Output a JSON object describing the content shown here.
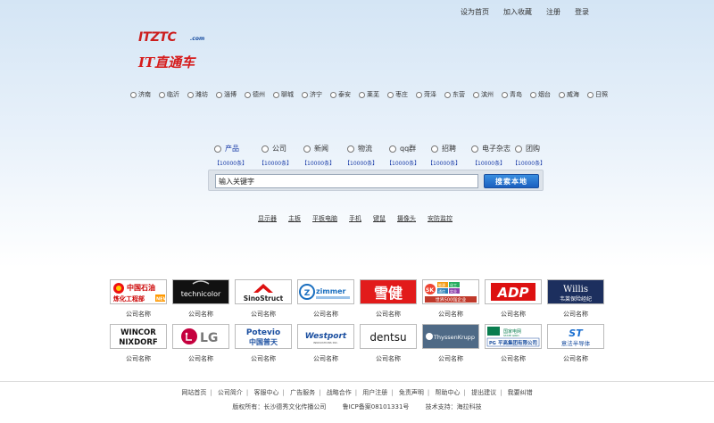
{
  "top_links": [
    "设为首页",
    "加入收藏",
    "注册",
    "登录"
  ],
  "logo": {
    "brand_en": "ITZTC",
    "brand_dotcom": ".com",
    "brand_cn": "IT直通车"
  },
  "cities": [
    "济南",
    "临沂",
    "潍坊",
    "淄博",
    "德州",
    "聊城",
    "济宁",
    "泰安",
    "莱芜",
    "枣庄",
    "菏泽",
    "东营",
    "滨州",
    "青岛",
    "烟台",
    "威海",
    "日照"
  ],
  "categories": [
    {
      "label": "产品",
      "count": "【10000条】",
      "selected": true
    },
    {
      "label": "公司",
      "count": "【10000条】"
    },
    {
      "label": "新闻",
      "count": "【10000条】"
    },
    {
      "label": "物流",
      "count": "【10000条】"
    },
    {
      "label": "qq群",
      "count": "【10000条】"
    },
    {
      "label": "招聘",
      "count": "【10000条】"
    },
    {
      "label": "电子杂志",
      "count": "【10000条】"
    },
    {
      "label": "团购",
      "count": "【10000条】"
    }
  ],
  "search": {
    "value": "输入关键字",
    "button": "搜索本地"
  },
  "hot_words": [
    "显示器",
    "主板",
    "平板电脑",
    "手机",
    "键鼠",
    "摄像头",
    "安防监控"
  ],
  "companies": [
    {
      "logo": "中国石油 炼化工程部 NEW",
      "caption": "公司名称"
    },
    {
      "logo": "technicolor",
      "caption": "公司名称"
    },
    {
      "logo": "SinoStruct",
      "caption": "公司名称"
    },
    {
      "logo": "zimmer",
      "caption": "公司名称"
    },
    {
      "logo": "雪健",
      "caption": "公司名称"
    },
    {
      "logo": "SK 能源 化工 通信 实业 世界500强企业",
      "caption": "公司名称"
    },
    {
      "logo": "ADP",
      "caption": "公司名称"
    },
    {
      "logo": "Willis 韦莱保险经纪",
      "caption": "公司名称"
    },
    {
      "logo": "WINCOR NIXDORF",
      "caption": "公司名称"
    },
    {
      "logo": "LG",
      "caption": "公司名称"
    },
    {
      "logo": "Potevio 中国普天",
      "caption": "公司名称"
    },
    {
      "logo": "Westport",
      "caption": "公司名称"
    },
    {
      "logo": "dentsu",
      "caption": "公司名称"
    },
    {
      "logo": "ThyssenKrupp",
      "caption": "公司名称"
    },
    {
      "logo": "国家电网 平高集团有限公司",
      "caption": "公司名称"
    },
    {
      "logo": "ST 意法半导体",
      "caption": "公司名称"
    }
  ],
  "footer": {
    "nav": [
      "网站首页",
      "公司简介",
      "客服中心",
      "广告服务",
      "战略合作",
      "用户注册",
      "免责声明",
      "帮助中心",
      "提出建议",
      "我要纠错"
    ],
    "copyright": "版权所有：长沙德秀文化传播公司",
    "icp": "鲁ICP备案08101331号",
    "support": "技术支持：海拉科技"
  }
}
